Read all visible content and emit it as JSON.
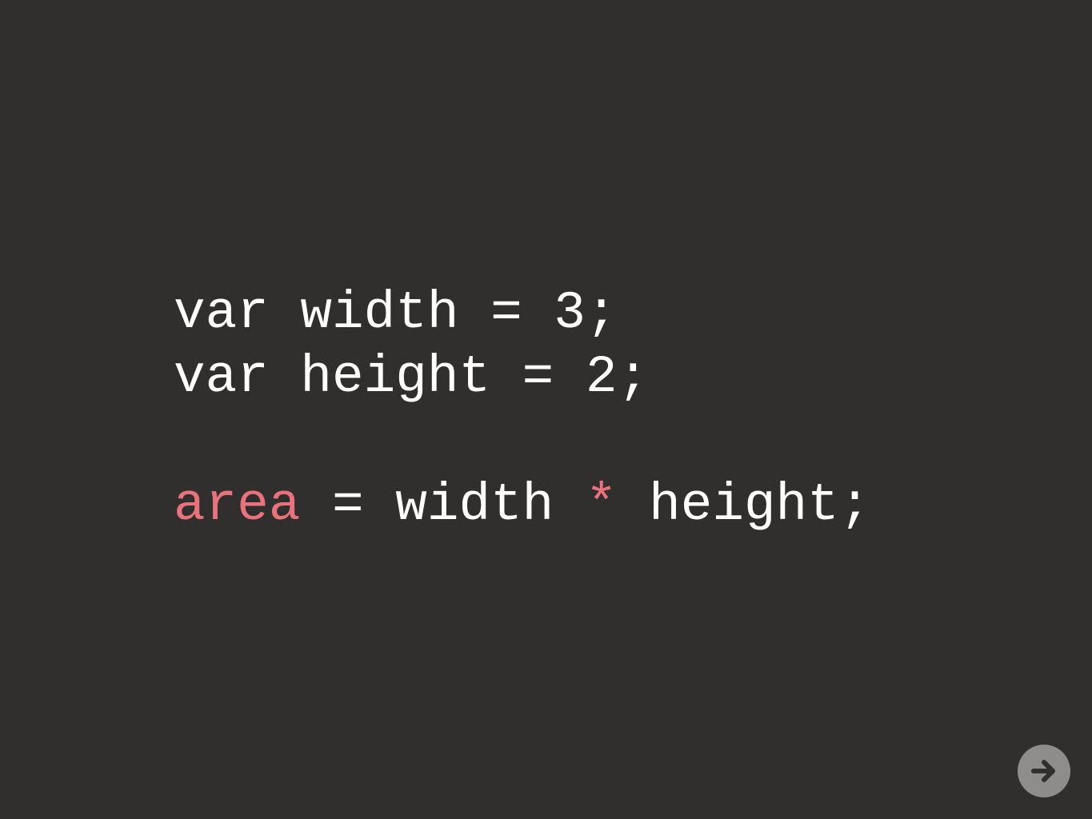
{
  "colors": {
    "background": "#302f2e",
    "text": "#ffffff",
    "highlight": "#e8737c",
    "button": "#8e8d8c",
    "button_icon": "#302f2e"
  },
  "code": {
    "line1": {
      "text": "var width = 3;"
    },
    "line2": {
      "text": "var height = 2;"
    },
    "line3": {
      "var_name": "area",
      "op_assign": " = width ",
      "op_mult": "*",
      "rest": " height;"
    }
  },
  "navigation": {
    "next_icon": "arrow-right-icon"
  }
}
